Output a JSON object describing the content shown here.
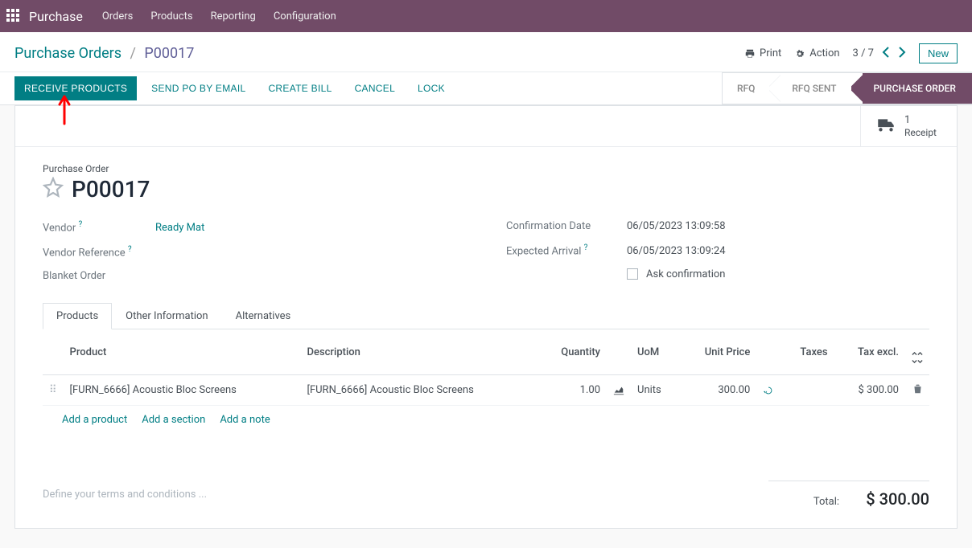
{
  "menubar": {
    "brand": "Purchase",
    "items": [
      "Orders",
      "Products",
      "Reporting",
      "Configuration"
    ]
  },
  "breadcrumb": {
    "parent": "Purchase Orders",
    "current": "P00017"
  },
  "control": {
    "print": "Print",
    "action": "Action",
    "pager": "3 / 7",
    "new": "New"
  },
  "buttons": {
    "receive": "RECEIVE PRODUCTS",
    "send_po": "SEND PO BY EMAIL",
    "create_bill": "CREATE BILL",
    "cancel": "CANCEL",
    "lock": "LOCK"
  },
  "status": {
    "rfq": "RFQ",
    "rfq_sent": "RFQ SENT",
    "po": "PURCHASE ORDER"
  },
  "stat_button": {
    "count": "1",
    "label": "Receipt"
  },
  "title": {
    "label": "Purchase Order",
    "name": "P00017"
  },
  "fields": {
    "vendor_label": "Vendor",
    "vendor_value": "Ready Mat",
    "vendor_ref_label": "Vendor Reference",
    "blanket_label": "Blanket Order",
    "confirm_label": "Confirmation Date",
    "confirm_value": "06/05/2023 13:09:58",
    "expected_label": "Expected Arrival",
    "expected_value": "06/05/2023 13:09:24",
    "ask_conf_label": "Ask confirmation"
  },
  "tabs": {
    "products": "Products",
    "other": "Other Information",
    "alternatives": "Alternatives"
  },
  "columns": {
    "product": "Product",
    "description": "Description",
    "quantity": "Quantity",
    "uom": "UoM",
    "unit_price": "Unit Price",
    "taxes": "Taxes",
    "tax_excl": "Tax excl."
  },
  "lines": [
    {
      "product": "[FURN_6666] Acoustic Bloc Screens",
      "description": "[FURN_6666] Acoustic Bloc Screens",
      "quantity": "1.00",
      "uom": "Units",
      "unit_price": "300.00",
      "tax_excl": "$ 300.00"
    }
  ],
  "add": {
    "product": "Add a product",
    "section": "Add a section",
    "note": "Add a note"
  },
  "terms_placeholder": "Define your terms and conditions ...",
  "totals": {
    "label": "Total:",
    "value": "$ 300.00"
  }
}
